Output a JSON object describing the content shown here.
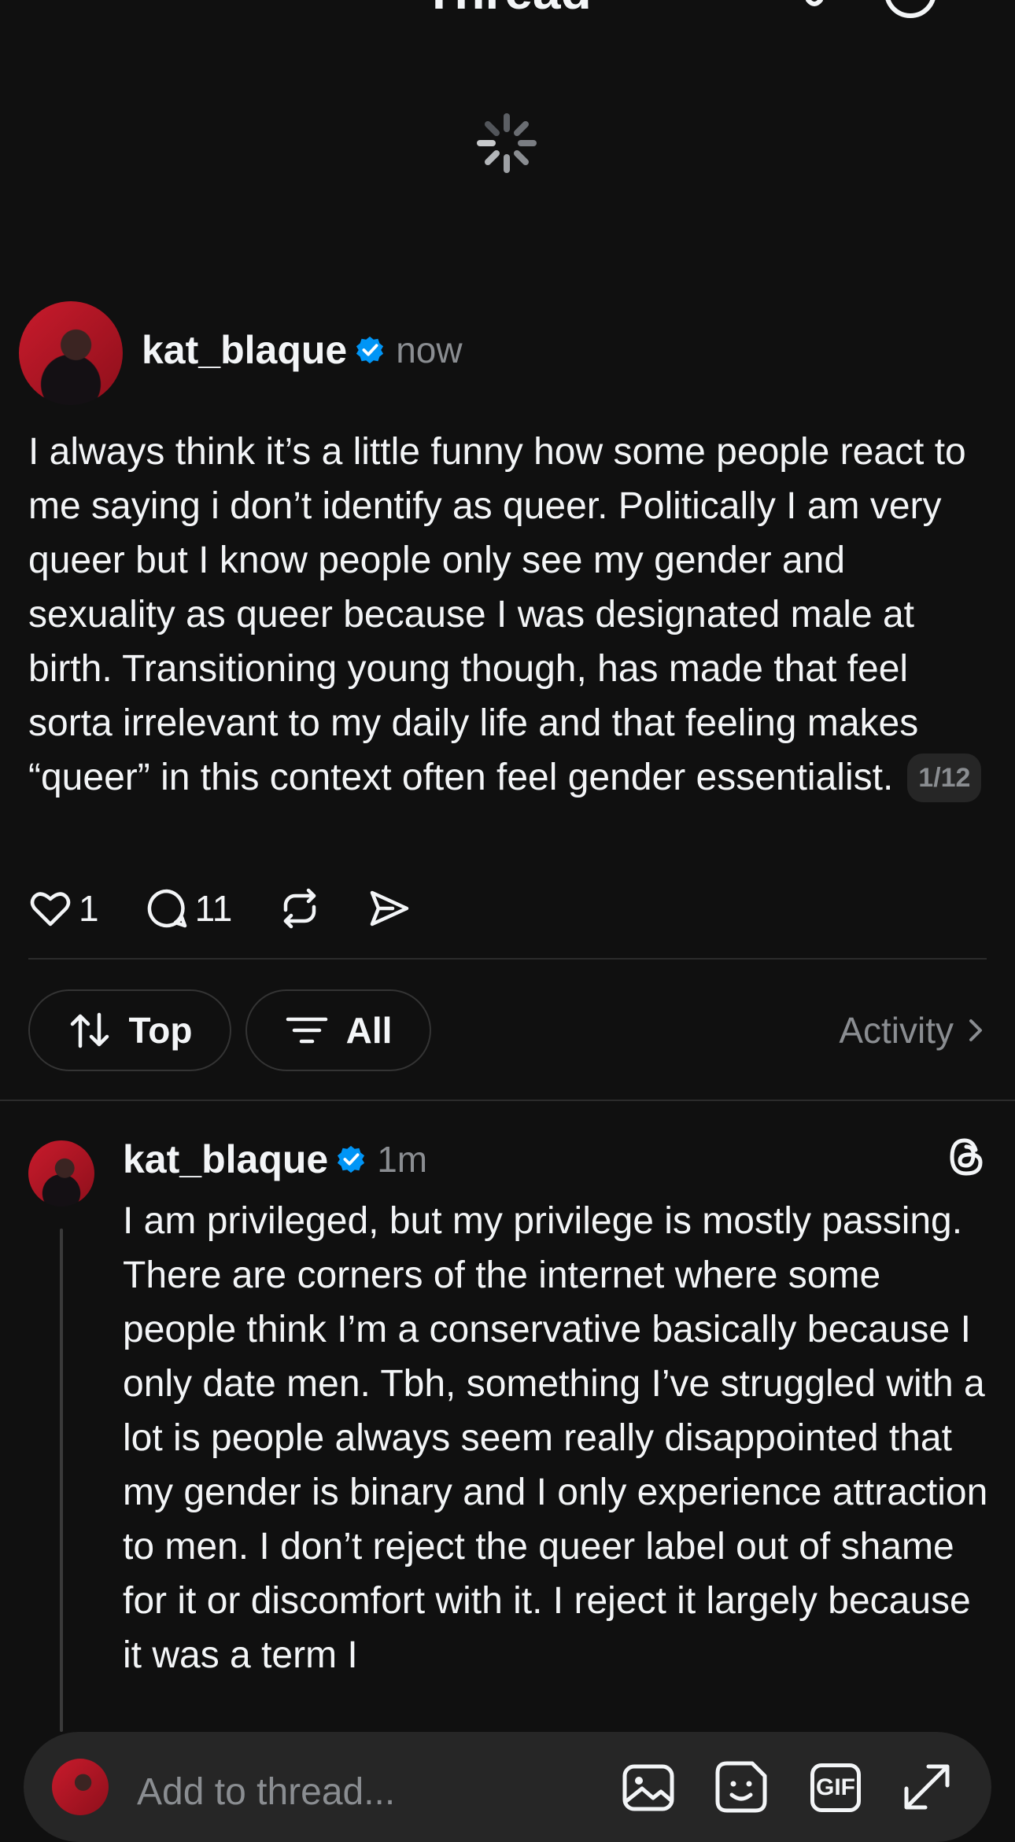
{
  "header": {
    "title": "Thread"
  },
  "post": {
    "username": "kat_blaque",
    "timestamp": "now",
    "text": "I always think it’s a little funny how some people react to me saying i don’t identify as queer. Politically I am very queer but I know people only see my gender and sexuality as queer because I was designated male at birth. Transitioning young though, has made that feel sorta irrelevant to my daily life and that feeling makes “queer” in this context often feel gender essentialist.",
    "page_badge": "1/12",
    "likes": "1",
    "replies": "11"
  },
  "controls": {
    "sort_label": "Top",
    "filter_label": "All",
    "activity_label": "Activity"
  },
  "reply": {
    "username": "kat_blaque",
    "timestamp": "1m",
    "text": "I am privileged, but my privilege is mostly passing. There are corners of the internet where some people think I’m a conservative basically because I only date men. Tbh, something I’ve struggled with a lot is people always seem really disappointed that my gender is binary and I only experience attraction to men. I don’t reject the queer label out of shame for it or discomfort with it. I reject it largely because it was a term I"
  },
  "composer": {
    "placeholder": "Add to thread...",
    "gif_label": "GIF"
  },
  "colors": {
    "background": "#101010",
    "text": "#f3f5f7",
    "secondary_text": "#8a8d91",
    "verified": "#0095f6"
  }
}
